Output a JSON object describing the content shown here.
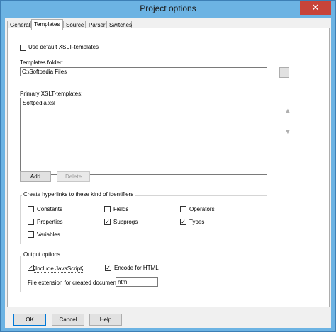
{
  "window": {
    "title": "Project options",
    "close_glyph": "✕"
  },
  "tabs": [
    {
      "label": "General",
      "active": false
    },
    {
      "label": "Templates",
      "active": true
    },
    {
      "label": "Source",
      "active": false
    },
    {
      "label": "Parser",
      "active": false
    },
    {
      "label": "Switches",
      "active": false
    }
  ],
  "templates": {
    "use_default_label": "Use default XSLT-templates",
    "use_default_checked": false,
    "folder_label": "Templates folder:",
    "folder_value": "C:\\Softpedia Files",
    "browse_label": "...",
    "primary_label": "Primary XSLT-templates:",
    "primary_items": [
      "Softpedia.xsl"
    ],
    "move_up_icon": "arrow-up-icon",
    "move_down_icon": "arrow-down-icon",
    "add_label": "Add",
    "delete_label": "Delete"
  },
  "hyperlinks": {
    "title": "Create hyperlinks to these kind of identifiers",
    "items": [
      {
        "label": "Constants",
        "checked": false
      },
      {
        "label": "Fields",
        "checked": false
      },
      {
        "label": "Operators",
        "checked": false
      },
      {
        "label": "Properties",
        "checked": false
      },
      {
        "label": "Subprogs",
        "checked": true
      },
      {
        "label": "Types",
        "checked": true
      },
      {
        "label": "Variables",
        "checked": false
      }
    ]
  },
  "output": {
    "title": "Output options",
    "include_js_label": "Include JavaScript",
    "include_js_checked": true,
    "encode_html_label": "Encode for HTML",
    "encode_html_checked": true,
    "ext_label": "File extension for created documents:",
    "ext_value": "htm"
  },
  "buttons": {
    "ok": "OK",
    "cancel": "Cancel",
    "help": "Help"
  },
  "check_glyph": "✓"
}
